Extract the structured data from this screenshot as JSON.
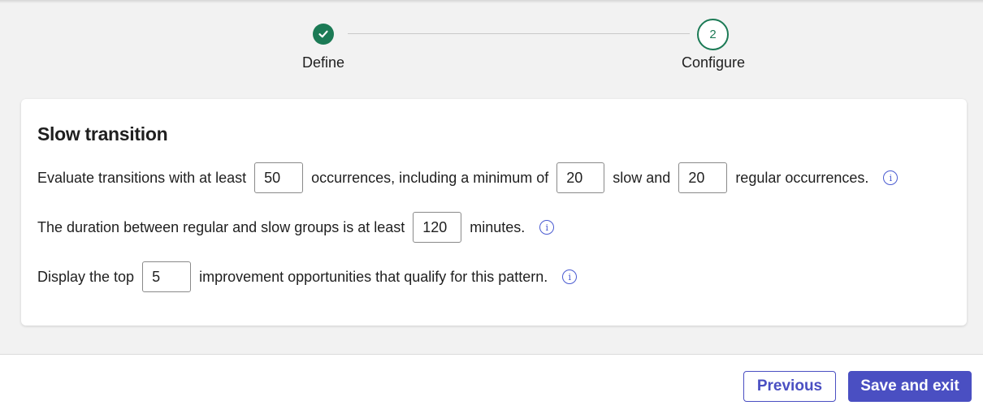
{
  "stepper": {
    "steps": [
      {
        "label": "Define",
        "state": "complete",
        "icon": "check-icon"
      },
      {
        "label": "Configure",
        "number": "2",
        "state": "current"
      }
    ],
    "accent_color": "#1b7a55"
  },
  "card": {
    "title": "Slow transition",
    "row1": {
      "text1": "Evaluate transitions with at least",
      "min_occurrences": "50",
      "text2": "occurrences, including a minimum of",
      "min_slow": "20",
      "text3": "slow and",
      "min_regular": "20",
      "text4": "regular occurrences."
    },
    "row2": {
      "text1": "The duration between regular and slow groups is at least",
      "duration": "120",
      "text2": "minutes."
    },
    "row3": {
      "text1": "Display the top",
      "top_count": "5",
      "text2": "improvement opportunities that qualify for this pattern."
    },
    "info_icon": "info-icon",
    "info_color": "#4a5bd1"
  },
  "footer": {
    "previous_label": "Previous",
    "save_label": "Save and exit",
    "primary_color": "#4a4fc2"
  }
}
